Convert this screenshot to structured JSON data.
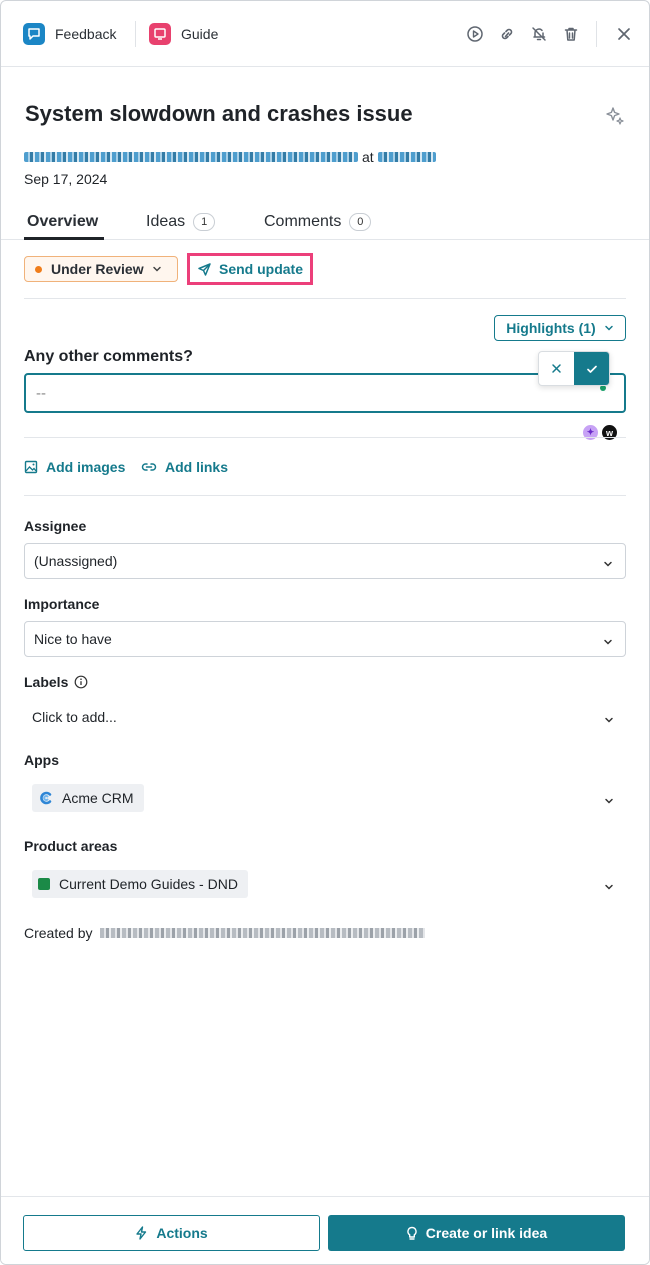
{
  "topbar": {
    "feedback_label": "Feedback",
    "guide_label": "Guide",
    "feedback_color": "#1b86c5",
    "guide_color": "#e8416e"
  },
  "header": {
    "title": "System slowdown and crashes issue",
    "at_word": "at",
    "date": "Sep 17, 2024"
  },
  "tabs": [
    {
      "label": "Overview"
    },
    {
      "label": "Ideas",
      "count": "1"
    },
    {
      "label": "Comments",
      "count": "0"
    }
  ],
  "status": {
    "label": "Under Review",
    "dot_color": "#f07d1a",
    "send_update_label": "Send update"
  },
  "highlights_label": "Highlights (1)",
  "comments_field": {
    "label": "Any other comments?",
    "value": "--"
  },
  "add": {
    "images_label": "Add images",
    "links_label": "Add links"
  },
  "fields": {
    "assignee": {
      "label": "Assignee",
      "value": "(Unassigned)"
    },
    "importance": {
      "label": "Importance",
      "value": "Nice to have"
    },
    "labels": {
      "label": "Labels",
      "placeholder": "Click to add..."
    },
    "apps": {
      "label": "Apps",
      "value": "Acme CRM"
    },
    "product_areas": {
      "label": "Product areas",
      "value": "Current Demo Guides - DND"
    }
  },
  "created_by_label": "Created by",
  "footer": {
    "actions_label": "Actions",
    "create_label": "Create or link idea",
    "accent_color": "#157a8c"
  }
}
